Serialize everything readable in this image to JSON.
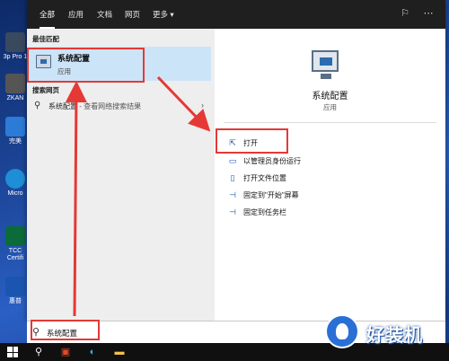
{
  "desktop": {
    "icons": [
      {
        "label": "3p Pro 1"
      },
      {
        "label": "ZKAN"
      },
      {
        "label": "完美"
      },
      {
        "label": "Micro"
      },
      {
        "label": "TCC Certifi"
      },
      {
        "label": "惠普"
      }
    ]
  },
  "topbar": {
    "tabs": [
      "全部",
      "应用",
      "文档",
      "网页",
      "更多 ▾"
    ],
    "icons": [
      "feedback-icon",
      "more-icon"
    ]
  },
  "left": {
    "best_match_label": "最佳匹配",
    "best_match": {
      "title": "系统配置",
      "subtitle": "应用"
    },
    "web_label": "搜索网页",
    "web_result": {
      "query": "系统配置",
      "suffix": " - 查看网络搜索结果"
    }
  },
  "right": {
    "app_name": "系统配置",
    "app_type": "应用",
    "actions": [
      {
        "label": "打开",
        "icon": "open-icon"
      },
      {
        "label": "以管理员身份运行",
        "icon": "shield-icon"
      },
      {
        "label": "打开文件位置",
        "icon": "file-icon"
      },
      {
        "label": "固定到\"开始\"屏幕",
        "icon": "pin-icon"
      },
      {
        "label": "固定到任务栏",
        "icon": "pin-icon"
      }
    ]
  },
  "search": {
    "value": "系统配置"
  },
  "watermark": {
    "text": "好装机"
  },
  "colors": {
    "highlight": "#e53935",
    "selected": "#cce4f7",
    "accent": "#1e5aa8"
  }
}
